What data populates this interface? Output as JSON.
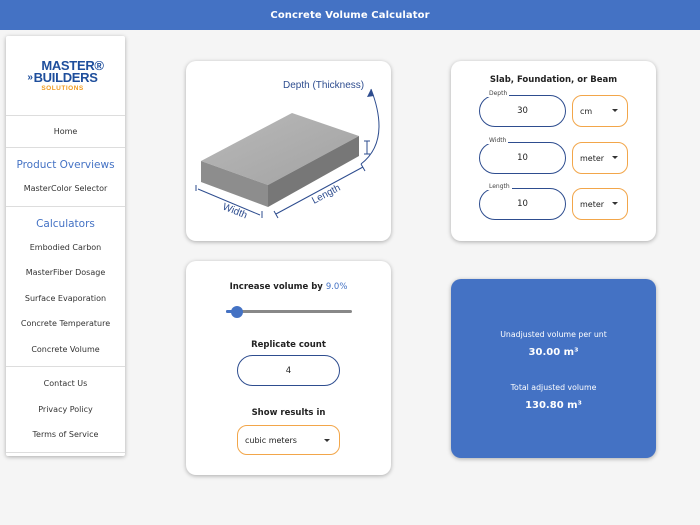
{
  "header": {
    "title": "Concrete Volume Calculator"
  },
  "brand": {
    "line1": "MASTER®",
    "line2": "BUILDERS",
    "line3": "SOLUTIONS"
  },
  "sidebar": {
    "home": "Home",
    "products_heading": "Product Overviews",
    "products": [
      "MasterColor Selector"
    ],
    "calculators_heading": "Calculators",
    "calculators": [
      "Embodied Carbon",
      "MasterFiber Dosage",
      "Surface Evaporation",
      "Concrete Temperature",
      "Concrete Volume"
    ],
    "info": [
      "Contact Us",
      "Privacy Policy",
      "Terms of Service"
    ]
  },
  "diagram": {
    "depth_label": "Depth (Thickness)",
    "width_label": "Width",
    "length_label": "Length"
  },
  "dimensions": {
    "title": "Slab, Foundation, or Beam",
    "fields": [
      {
        "label": "Depth",
        "value": "30",
        "unit": "cm"
      },
      {
        "label": "Width",
        "value": "10",
        "unit": "meter"
      },
      {
        "label": "Length",
        "value": "10",
        "unit": "meter"
      }
    ]
  },
  "options": {
    "increase_label": "Increase volume by",
    "increase_value": "9.0%",
    "slider_fraction": 0.09,
    "replicate_label": "Replicate count",
    "replicate_value": "4",
    "results_in_label": "Show results in",
    "results_in_value": "cubic meters"
  },
  "results": {
    "unadjusted_label": "Unadjusted volume per unt",
    "unadjusted_value": "30.00 m³",
    "total_label": "Total adjusted volume",
    "total_value": "130.80 m³"
  },
  "colors": {
    "primary": "#4472c4",
    "accent_orange": "#f2a64a",
    "brand_blue": "#1e4e9c",
    "brand_orange": "#f29b1d"
  }
}
